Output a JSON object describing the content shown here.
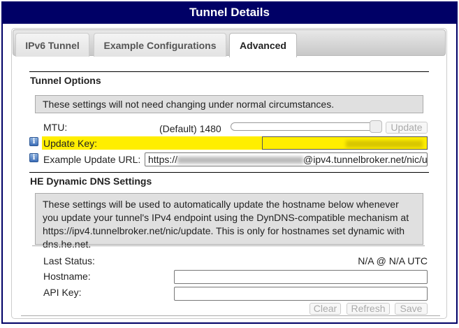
{
  "header": {
    "title": "Tunnel Details"
  },
  "tabs": [
    {
      "label": "IPv6 Tunnel"
    },
    {
      "label": "Example Configurations"
    },
    {
      "label": "Advanced",
      "active": true
    }
  ],
  "tunnel_options": {
    "title": "Tunnel Options",
    "note": "These settings will not need changing under normal circumstances.",
    "mtu_label": "MTU:",
    "mtu_value": "(Default) 1480",
    "update_button": "Update",
    "update_key_label": "Update Key:",
    "example_url_label": "Example Update URL:",
    "example_url_prefix": "https://",
    "example_url_suffix": "@ipv4.tunnelbroker.net/nic/u"
  },
  "dns": {
    "title": "HE Dynamic DNS Settings",
    "note": "These settings will be used to automatically update the hostname below whenever you update your tunnel's IPv4 endpoint using the DynDNS-compatible mechanism at https://ipv4.tunnelbroker.net/nic/update. This is only for hostnames set dynamic with dns.he.net.",
    "last_status_label": "Last Status:",
    "last_status_value": "N/A @ N/A UTC",
    "hostname_label": "Hostname:",
    "hostname_value": "",
    "api_key_label": "API Key:",
    "api_key_value": "",
    "buttons": {
      "clear": "Clear",
      "refresh": "Refresh",
      "save": "Save"
    }
  },
  "colors": {
    "header": "#000066",
    "highlight": "#ffee00"
  }
}
